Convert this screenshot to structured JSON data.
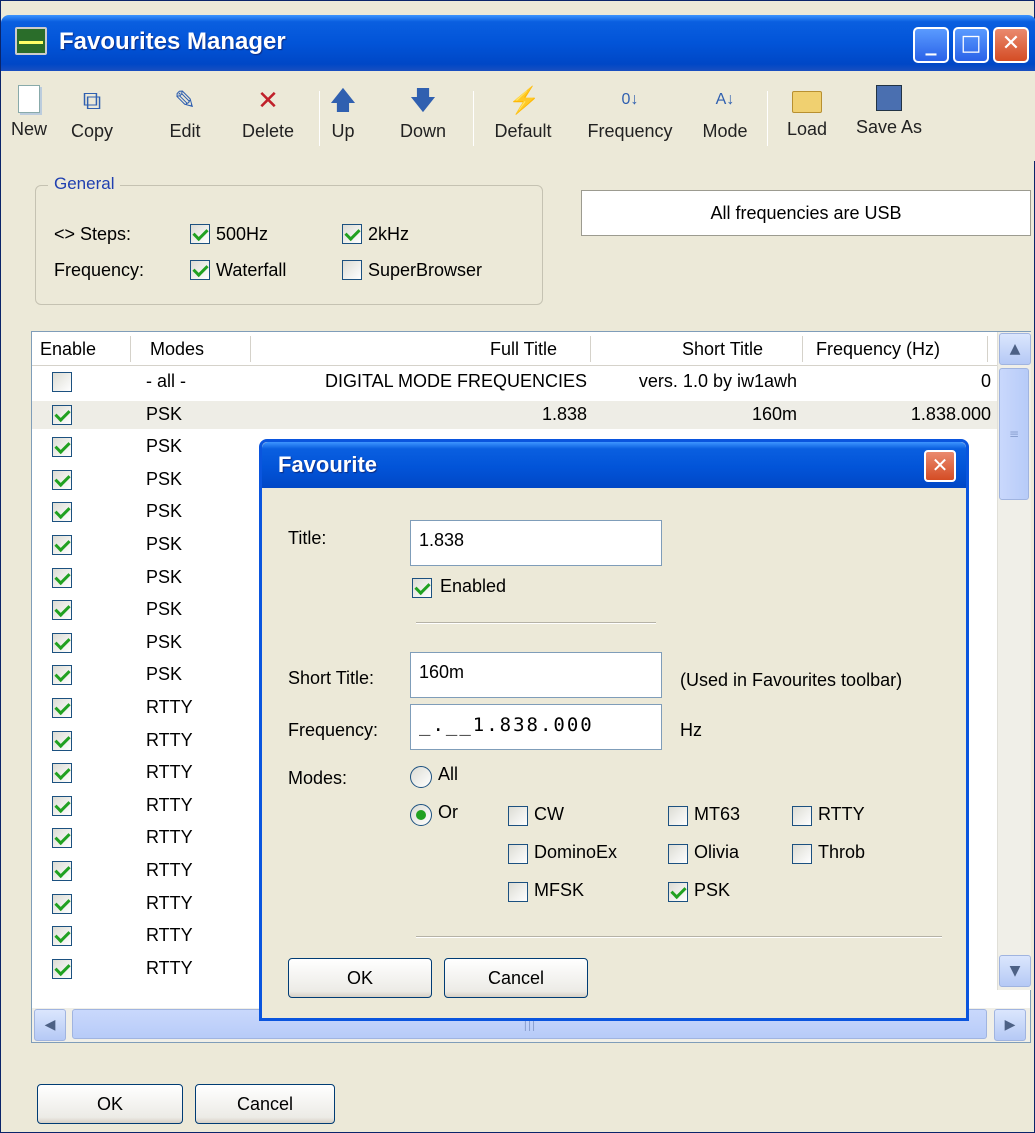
{
  "window": {
    "title": "Favourites Manager",
    "minimize": "_",
    "maximize": "□",
    "close": "✕"
  },
  "toolbar": [
    {
      "label": "New",
      "icon": "new-document-icon"
    },
    {
      "label": "Copy",
      "icon": "copy-icon"
    },
    {
      "label": "Edit",
      "icon": "edit-icon"
    },
    {
      "label": "Delete",
      "icon": "delete-icon"
    },
    {
      "label": "Up",
      "icon": "arrow-up-icon"
    },
    {
      "label": "Down",
      "icon": "arrow-down-icon"
    },
    {
      "label": "Default",
      "icon": "default-icon"
    },
    {
      "label": "Frequency",
      "icon": "sort-numeric-icon"
    },
    {
      "label": "Mode",
      "icon": "sort-alpha-icon"
    },
    {
      "label": "Load",
      "icon": "folder-icon"
    },
    {
      "label": "Save As",
      "icon": "save-icon"
    }
  ],
  "general": {
    "legend": "General",
    "steps_label": "<>  Steps:",
    "frequency_label": "Frequency:",
    "opt_500hz": {
      "label": "500Hz",
      "checked": true
    },
    "opt_2khz": {
      "label": "2kHz",
      "checked": true
    },
    "opt_waterfall": {
      "label": "Waterfall",
      "checked": true
    },
    "opt_superbrowser": {
      "label": "SuperBrowser",
      "checked": false
    }
  },
  "info": "All frequencies are USB",
  "table": {
    "headers": {
      "enable": "Enable",
      "modes": "Modes",
      "full_title": "Full Title",
      "short_title": "Short Title",
      "frequency": "Frequency (Hz)"
    },
    "rows": [
      {
        "enabled": false,
        "mode": "- all -",
        "full_title": "DIGITAL MODE FREQUENCIES",
        "short_title": "vers. 1.0 by iw1awh",
        "frequency": "0"
      },
      {
        "enabled": true,
        "mode": "PSK",
        "full_title": "1.838",
        "short_title": "160m",
        "frequency": "1.838.000"
      },
      {
        "enabled": true,
        "mode": "PSK",
        "full_title": "",
        "short_title": "",
        "frequency": ""
      },
      {
        "enabled": true,
        "mode": "PSK",
        "full_title": "",
        "short_title": "",
        "frequency": ""
      },
      {
        "enabled": true,
        "mode": "PSK",
        "full_title": "",
        "short_title": "",
        "frequency": ""
      },
      {
        "enabled": true,
        "mode": "PSK",
        "full_title": "",
        "short_title": "",
        "frequency": ""
      },
      {
        "enabled": true,
        "mode": "PSK",
        "full_title": "",
        "short_title": "",
        "frequency": ""
      },
      {
        "enabled": true,
        "mode": "PSK",
        "full_title": "",
        "short_title": "",
        "frequency": ""
      },
      {
        "enabled": true,
        "mode": "PSK",
        "full_title": "",
        "short_title": "",
        "frequency": ""
      },
      {
        "enabled": true,
        "mode": "PSK",
        "full_title": "",
        "short_title": "",
        "frequency": ""
      },
      {
        "enabled": true,
        "mode": "RTTY",
        "full_title": "",
        "short_title": "",
        "frequency": ""
      },
      {
        "enabled": true,
        "mode": "RTTY",
        "full_title": "",
        "short_title": "",
        "frequency": ""
      },
      {
        "enabled": true,
        "mode": "RTTY",
        "full_title": "",
        "short_title": "",
        "frequency": ""
      },
      {
        "enabled": true,
        "mode": "RTTY",
        "full_title": "",
        "short_title": "",
        "frequency": ""
      },
      {
        "enabled": true,
        "mode": "RTTY",
        "full_title": "",
        "short_title": "",
        "frequency": ""
      },
      {
        "enabled": true,
        "mode": "RTTY",
        "full_title": "",
        "short_title": "",
        "frequency": ""
      },
      {
        "enabled": true,
        "mode": "RTTY",
        "full_title": "",
        "short_title": "",
        "frequency": ""
      },
      {
        "enabled": true,
        "mode": "RTTY",
        "full_title": "",
        "short_title": "",
        "frequency": ""
      },
      {
        "enabled": true,
        "mode": "RTTY",
        "full_title": "",
        "short_title": "",
        "frequency": ""
      }
    ]
  },
  "footer": {
    "ok": "OK",
    "cancel": "Cancel"
  },
  "dialog": {
    "title": "Favourite",
    "close": "✕",
    "title_label": "Title:",
    "title_value": "1.838",
    "enabled_label": "Enabled",
    "enabled": true,
    "short_title_label": "Short Title:",
    "short_title_value": "160m",
    "short_title_hint": "(Used in Favourites toolbar)",
    "frequency_label": "Frequency:",
    "frequency_value": "_.__1.838.000",
    "frequency_unit": "Hz",
    "modes_label": "Modes:",
    "radio_all": {
      "label": "All",
      "selected": false
    },
    "radio_or": {
      "label": "Or",
      "selected": true
    },
    "modes": [
      {
        "label": "CW",
        "checked": false
      },
      {
        "label": "MT63",
        "checked": false
      },
      {
        "label": "RTTY",
        "checked": false
      },
      {
        "label": "DominoEx",
        "checked": false
      },
      {
        "label": "Olivia",
        "checked": false
      },
      {
        "label": "Throb",
        "checked": false
      },
      {
        "label": "MFSK",
        "checked": false
      },
      {
        "label": "PSK",
        "checked": true
      }
    ],
    "ok": "OK",
    "cancel": "Cancel"
  }
}
